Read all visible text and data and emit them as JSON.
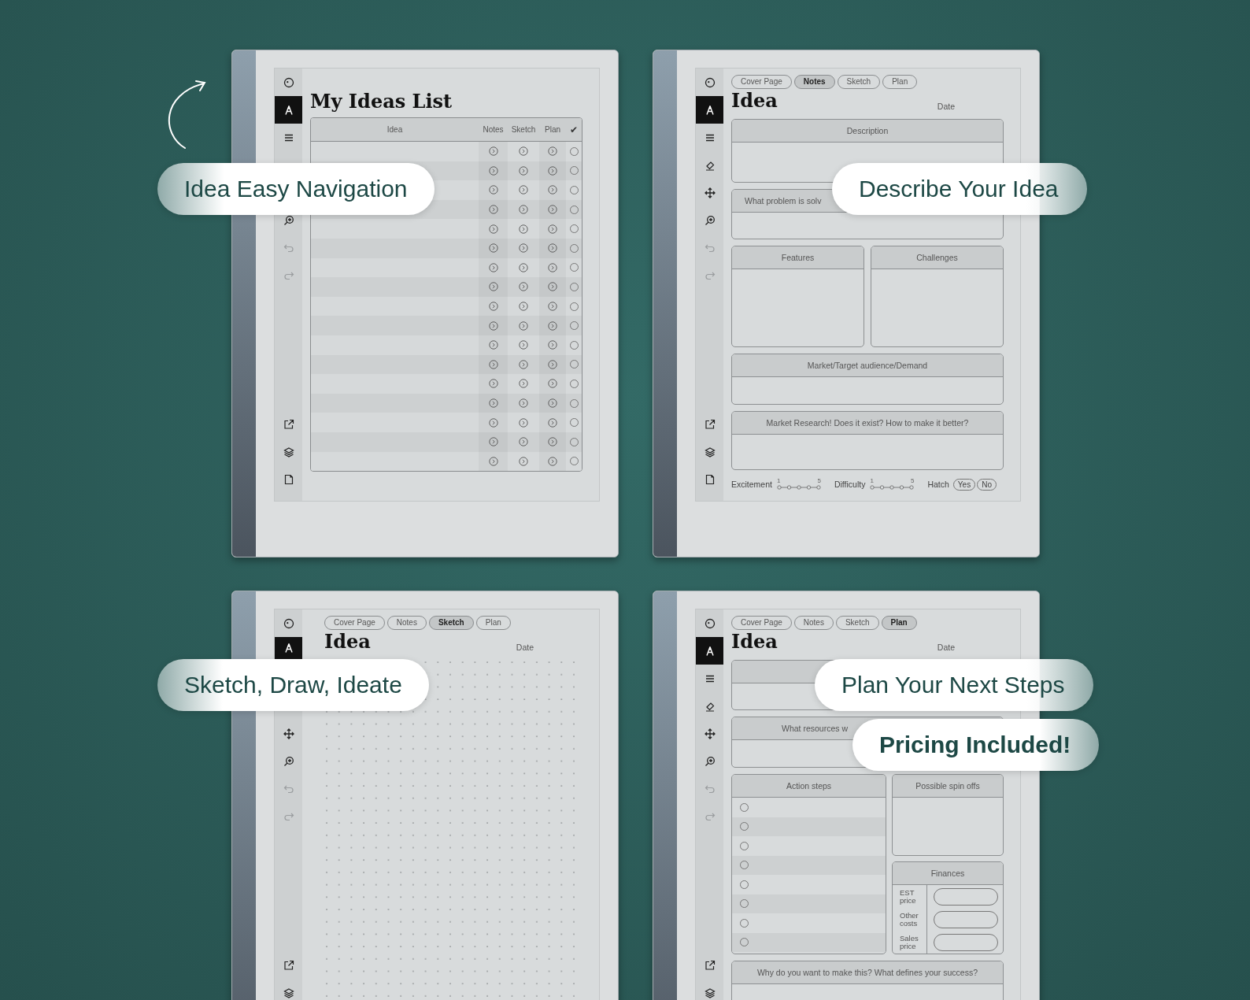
{
  "pages": [
    {
      "kind": "list",
      "title": "My Ideas List",
      "columns": [
        "Idea",
        "Notes",
        "Sketch",
        "Plan",
        "✔"
      ],
      "rows": [
        {
          "checked": false
        },
        {
          "checked": false
        },
        {
          "checked": false
        },
        {
          "checked": false
        },
        {
          "checked": false
        },
        {
          "checked": false
        },
        {
          "checked": false
        },
        {
          "checked": false
        },
        {
          "checked": false
        },
        {
          "checked": false
        },
        {
          "checked": false
        },
        {
          "checked": false
        },
        {
          "checked": false
        },
        {
          "checked": false
        },
        {
          "checked": false
        },
        {
          "checked": false
        },
        {
          "checked": false
        }
      ]
    },
    {
      "kind": "notes",
      "tabs": [
        {
          "label": "Cover Page",
          "selected": false
        },
        {
          "label": "Notes",
          "selected": true
        },
        {
          "label": "Sketch",
          "selected": false
        },
        {
          "label": "Plan",
          "selected": false
        }
      ],
      "title": "Idea",
      "date_label": "Date",
      "boxes": [
        {
          "heading": "Description"
        },
        {
          "heading": "What problem is solv"
        }
      ],
      "pair": [
        {
          "heading": "Features"
        },
        {
          "heading": "Challenges"
        }
      ],
      "boxes_after": [
        {
          "heading": "Market/Target audience/Demand"
        },
        {
          "heading": "Market Research! Does it exist? How to make it better?"
        }
      ],
      "footer": {
        "scales": [
          {
            "label": "Excitement",
            "min": "1",
            "max": "5"
          },
          {
            "label": "Difficulty",
            "min": "1",
            "max": "5"
          }
        ],
        "hatch": {
          "label": "Hatch",
          "options": [
            {
              "label": "Yes",
              "selected": false
            },
            {
              "label": "No",
              "selected": false
            }
          ]
        }
      }
    },
    {
      "kind": "sketch",
      "tabs": [
        {
          "label": "Cover Page",
          "selected": false
        },
        {
          "label": "Notes",
          "selected": false
        },
        {
          "label": "Sketch",
          "selected": true
        },
        {
          "label": "Plan",
          "selected": false
        }
      ],
      "title": "Idea",
      "date_label": "Date"
    },
    {
      "kind": "plan",
      "tabs": [
        {
          "label": "Cover Page",
          "selected": false
        },
        {
          "label": "Notes",
          "selected": false
        },
        {
          "label": "Sketch",
          "selected": false
        },
        {
          "label": "Plan",
          "selected": true
        }
      ],
      "title": "Idea",
      "date_label": "Date",
      "boxes": [
        {
          "heading": "What resources w"
        }
      ],
      "action_steps": {
        "heading": "Action steps",
        "items": [
          {
            "checked": false
          },
          {
            "checked": false
          },
          {
            "checked": false
          },
          {
            "checked": false
          },
          {
            "checked": false
          },
          {
            "checked": false
          },
          {
            "checked": false
          },
          {
            "checked": false
          }
        ]
      },
      "spin_offs": {
        "heading": "Possible spin offs"
      },
      "finances": {
        "heading": "Finances",
        "rows": [
          {
            "label": "EST price"
          },
          {
            "label": "Other costs"
          },
          {
            "label": "Sales price"
          }
        ]
      },
      "closing": {
        "heading": "Why do you want to make this? What defines your success?"
      }
    }
  ],
  "callouts": [
    {
      "text": "Idea Easy Navigation",
      "bold": false
    },
    {
      "text": "Describe Your Idea",
      "bold": false
    },
    {
      "text": "Sketch, Draw, Ideate",
      "bold": false
    },
    {
      "text": "Plan Your Next Steps",
      "bold": false
    },
    {
      "text": "Pricing Included!",
      "bold": true
    }
  ]
}
